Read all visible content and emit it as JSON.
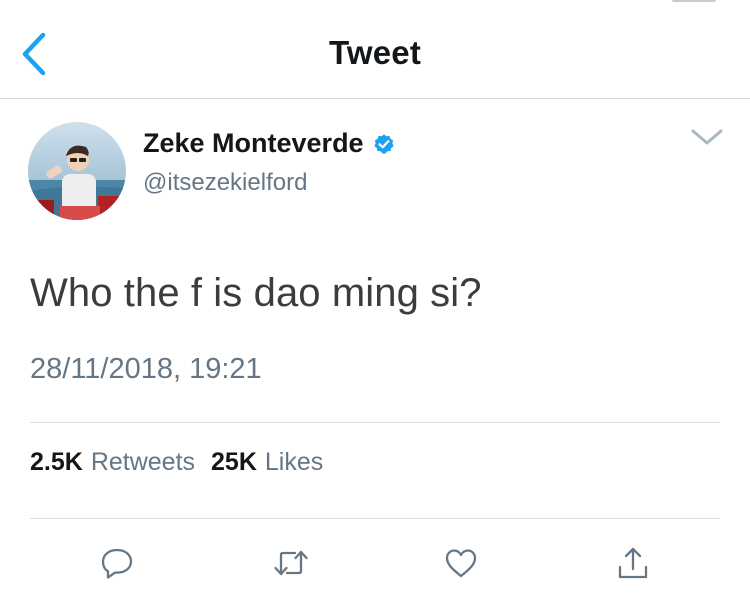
{
  "header": {
    "title": "Tweet",
    "back_icon": "chevron-left-icon",
    "accent_color": "#1da1f2"
  },
  "tweet": {
    "author": {
      "display_name": "Zeke Monteverde",
      "handle": "@itsezekielford",
      "verified": true,
      "verified_icon": "verified-badge-icon"
    },
    "text": "Who the f is dao ming si?",
    "timestamp": "28/11/2018, 19:21",
    "stats": {
      "retweets_count": "2.5K",
      "retweets_label": "Retweets",
      "likes_count": "25K",
      "likes_label": "Likes"
    },
    "more_icon": "chevron-down-icon"
  },
  "actions": [
    {
      "name": "reply",
      "icon": "reply-icon"
    },
    {
      "name": "retweet",
      "icon": "retweet-icon"
    },
    {
      "name": "like",
      "icon": "heart-icon"
    },
    {
      "name": "share",
      "icon": "share-icon"
    }
  ],
  "colors": {
    "text": "#14171a",
    "secondary_text": "#657786",
    "verified": "#1da1f2",
    "divider": "#d8dde1"
  }
}
